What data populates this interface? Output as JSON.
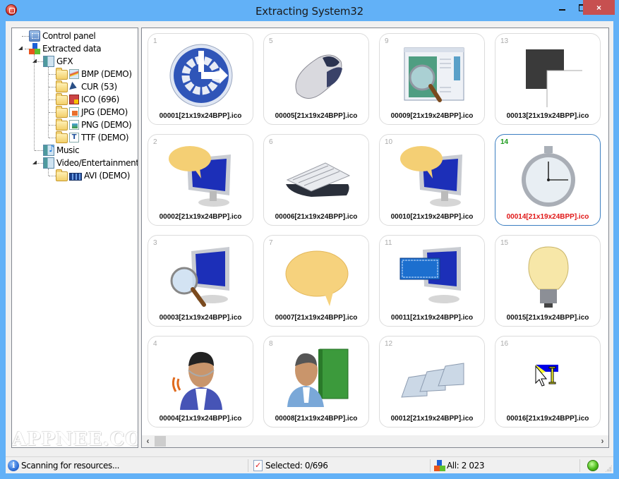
{
  "window": {
    "title": "Extracting System32",
    "controls": {
      "minimize": "minimize",
      "maximize": "maximize",
      "close": "×"
    }
  },
  "tree": {
    "items": [
      {
        "label": "Control panel",
        "icon": "control-panel-icon",
        "level": 0
      },
      {
        "label": "Extracted data",
        "icon": "extracted-data-icon",
        "level": 0,
        "expanded": true
      },
      {
        "label": "GFX",
        "icon": "gfx-category-icon",
        "level": 1,
        "expanded": true
      },
      {
        "label": "BMP (DEMO)",
        "icon": "bmp-icon",
        "level": 2
      },
      {
        "label": "CUR (53)",
        "icon": "cursor-icon",
        "level": 2
      },
      {
        "label": "ICO (696)",
        "icon": "ico-icon",
        "level": 2,
        "open": true
      },
      {
        "label": "JPG (DEMO)",
        "icon": "jpg-icon",
        "level": 2
      },
      {
        "label": "PNG (DEMO)",
        "icon": "png-icon",
        "level": 2
      },
      {
        "label": "TTF (DEMO)",
        "icon": "ttf-icon",
        "level": 2
      },
      {
        "label": "Music",
        "icon": "music-icon",
        "level": 1
      },
      {
        "label": "Video/Entertainment",
        "icon": "video-icon",
        "level": 1,
        "expanded": true
      },
      {
        "label": "AVI (DEMO)",
        "icon": "avi-icon",
        "level": 2
      }
    ],
    "watermark": "APPNEE.COM"
  },
  "gallery": {
    "items": [
      {
        "num": "1",
        "name": "00001[21x19x24BPP].ico",
        "icon": "accessibility-icon"
      },
      {
        "num": "5",
        "name": "00005[21x19x24BPP].ico",
        "icon": "mouse-icon"
      },
      {
        "num": "9",
        "name": "00009[21x19x24BPP].ico",
        "icon": "window-search-icon"
      },
      {
        "num": "13",
        "name": "00013[21x19x24BPP].ico",
        "icon": "overlapping-squares-icon"
      },
      {
        "num": "2",
        "name": "00002[21x19x24BPP].ico",
        "icon": "monitor-speech-icon"
      },
      {
        "num": "6",
        "name": "00006[21x19x24BPP].ico",
        "icon": "keyboard-icon"
      },
      {
        "num": "10",
        "name": "00010[21x19x24BPP].ico",
        "icon": "monitor-speech-icon"
      },
      {
        "num": "14",
        "name": "00014[21x19x24BPP].ico",
        "icon": "stopwatch-icon",
        "selected": true
      },
      {
        "num": "3",
        "name": "00003[21x19x24BPP].ico",
        "icon": "monitor-magnifier-icon"
      },
      {
        "num": "7",
        "name": "00007[21x19x24BPP].ico",
        "icon": "speech-bubble-icon"
      },
      {
        "num": "11",
        "name": "00011[21x19x24BPP].ico",
        "icon": "monitor-keyboard-icon"
      },
      {
        "num": "15",
        "name": "00015[21x19x24BPP].ico",
        "icon": "light-bulb-icon"
      },
      {
        "num": "4",
        "name": "00004[21x19x24BPP].ico",
        "icon": "headset-user-icon"
      },
      {
        "num": "8",
        "name": "00008[21x19x24BPP].ico",
        "icon": "user-book-icon"
      },
      {
        "num": "12",
        "name": "00012[21x19x24BPP].ico",
        "icon": "keys-icon"
      },
      {
        "num": "16",
        "name": "00016[21x19x24BPP].ico",
        "icon": "cursor-text-icon"
      }
    ],
    "scroll_left": "‹",
    "scroll_right": "›"
  },
  "status": {
    "message": "Scanning for resources...",
    "selected": "Selected: 0/696",
    "all": "All: 2 023"
  },
  "colors": {
    "titlebar": "#62b1f7",
    "close": "#c75050",
    "selected_border": "#3c7fc1",
    "selected_name": "#e01616",
    "selected_num": "#1a9a1a"
  }
}
